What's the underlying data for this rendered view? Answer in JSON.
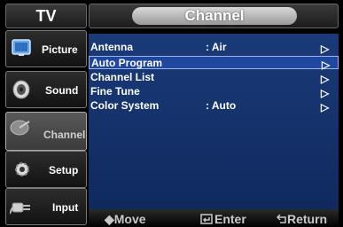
{
  "sidebar": {
    "title": "TV",
    "items": [
      {
        "label": "Picture",
        "icon": "picture-icon"
      },
      {
        "label": "Sound",
        "icon": "speaker-icon"
      },
      {
        "label": "Channel",
        "icon": "satellite-dish-icon",
        "active": true
      },
      {
        "label": "Setup",
        "icon": "gear-icon"
      },
      {
        "label": "Input",
        "icon": "plug-icon"
      }
    ]
  },
  "header": {
    "title": "Channel"
  },
  "menu": {
    "rows": [
      {
        "name": "Antenna",
        "value": ": Air",
        "arrow": "▷"
      },
      {
        "name": "Auto Program",
        "value": "",
        "arrow": "▷",
        "selected": true
      },
      {
        "name": "Channel List",
        "value": "",
        "arrow": "▷"
      },
      {
        "name": "Fine Tune",
        "value": "",
        "arrow": "▷"
      },
      {
        "name": "Color System",
        "value": ": Auto",
        "arrow": "▷"
      }
    ]
  },
  "footer": {
    "move": "◆Move",
    "enter": "Enter",
    "return": "Return"
  },
  "colors": {
    "menu_bg": "#163370",
    "selected_bg": "#1e47a0",
    "frame": "#000000"
  }
}
